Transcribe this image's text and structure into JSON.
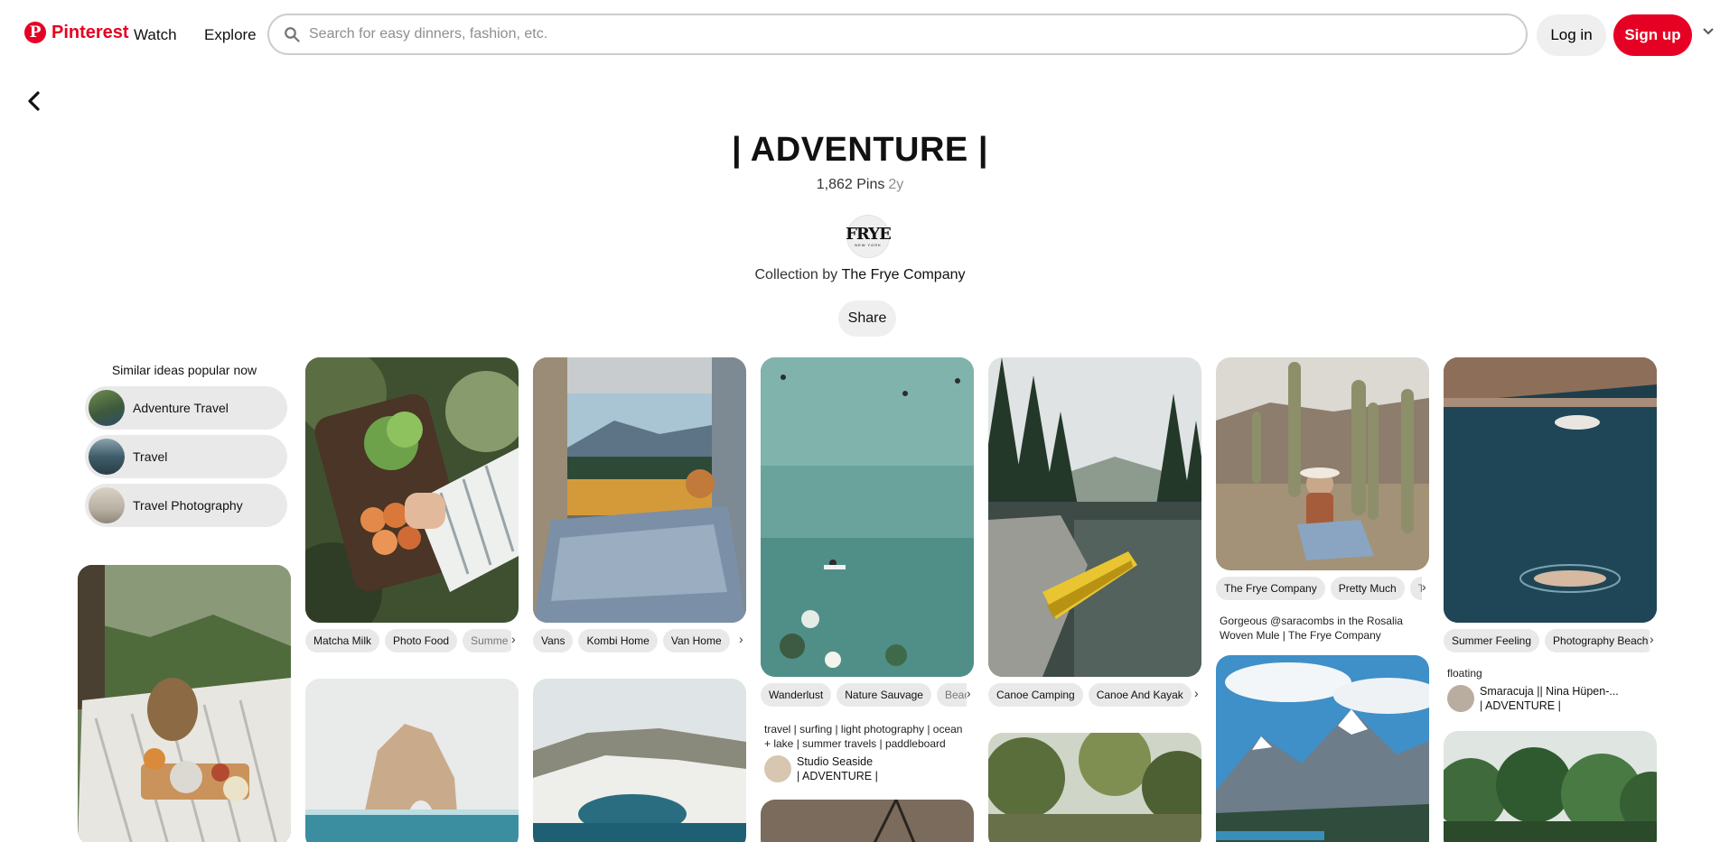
{
  "header": {
    "logo": "Pinterest",
    "watch": "Watch",
    "explore": "Explore",
    "search_placeholder": "Search for easy dinners, fashion, etc.",
    "login": "Log in",
    "signup": "Sign up"
  },
  "board": {
    "title": "| ADVENTURE |",
    "pins": "1,862 Pins",
    "age": "2y",
    "avatar_big": "FRYE",
    "avatar_small": "NEW YORK",
    "collection_prefix": "Collection by",
    "owner": "The Frye Company",
    "share": "Share"
  },
  "similar": {
    "title": "Similar ideas popular now",
    "items": [
      {
        "label": "Adventure Travel"
      },
      {
        "label": "Travel"
      },
      {
        "label": "Travel Photography"
      }
    ]
  },
  "pins": {
    "matcha": {
      "tags": [
        "Matcha Milk",
        "Photo Food",
        "Summe"
      ]
    },
    "van": {
      "tags": [
        "Vans",
        "Kombi Home",
        "Van Home"
      ]
    },
    "surf": {
      "tags": [
        "Wanderlust",
        "Nature Sauvage",
        "Beac"
      ],
      "description": "travel | surfing | light photography | ocean + lake | summer travels | paddleboard",
      "author": "Studio Seaside",
      "board": "| ADVENTURE |"
    },
    "canoe": {
      "tags": [
        "Canoe Camping",
        "Canoe And Kayak"
      ]
    },
    "cactus": {
      "tags": [
        "The Frye Company",
        "Pretty Much",
        "T"
      ],
      "description": "Gorgeous @saracombs in the Rosalia Woven Mule | The Frye Company"
    },
    "swim": {
      "tags": [
        "Summer Feeling",
        "Photography Beach"
      ],
      "description": "floating",
      "author": "Smaracuja || Nina Hüpen-...",
      "board": "| ADVENTURE |"
    }
  },
  "colors": {
    "brand": "#e60023",
    "chip_bg": "#e9e9e9"
  }
}
